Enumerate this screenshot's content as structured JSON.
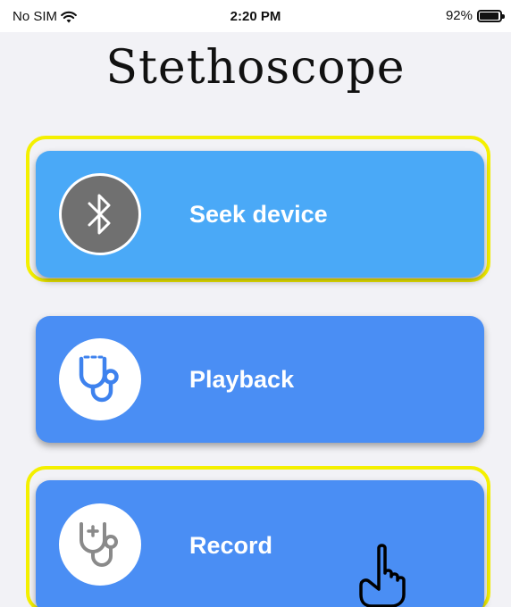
{
  "status_bar": {
    "carrier": "No SIM",
    "time": "2:20 PM",
    "battery": "92%",
    "wifi_icon": "wifi-icon",
    "battery_icon": "battery-icon"
  },
  "app": {
    "title": "Stethoscope"
  },
  "menu": {
    "items": [
      {
        "label": "Seek device",
        "icon": "bluetooth-icon",
        "color": "#4aa9f7",
        "highlighted": true
      },
      {
        "label": "Playback",
        "icon": "stethoscope-icon",
        "color": "#4a8ef4",
        "highlighted": false
      },
      {
        "label": "Record",
        "icon": "stethoscope-plus-icon",
        "color": "#4a8ef4",
        "highlighted": true
      }
    ]
  },
  "colors": {
    "highlight": "#f4f000",
    "background": "#f2f2f6"
  },
  "cursor_icon": "hand-pointer-icon"
}
